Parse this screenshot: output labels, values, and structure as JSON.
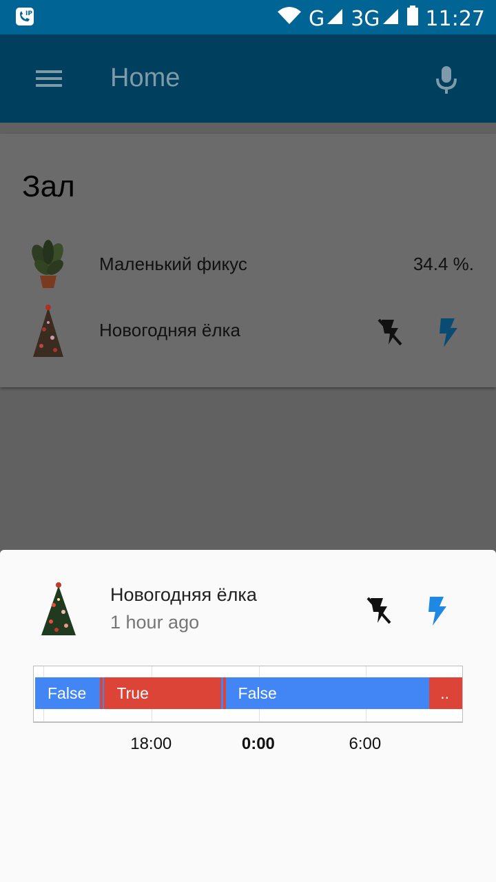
{
  "status_bar": {
    "time": "11:27",
    "network_1": "G",
    "network_2": "3G",
    "icons": [
      "sip-call-icon",
      "wifi-icon",
      "signal-icon",
      "battery-icon"
    ]
  },
  "app_bar": {
    "title": "Home",
    "menu_icon": "hamburger-menu-icon",
    "voice_icon": "microphone-icon"
  },
  "card": {
    "room": "Зал",
    "entities": [
      {
        "name": "Маленький фикус",
        "value": "34.4 %.",
        "icon": "ficus-plant-icon"
      },
      {
        "name": "Новогодняя ёлка",
        "icon": "christmas-tree-icon",
        "off_icon": "flash-off-icon",
        "on_icon": "flash-icon"
      }
    ]
  },
  "more_info": {
    "name": "Новогодняя ёлка",
    "last_changed": "1 hour ago",
    "icon": "christmas-tree-icon",
    "off_icon": "flash-off-icon",
    "on_icon": "flash-icon",
    "timeline": {
      "segments": [
        {
          "label": "False",
          "state": "false",
          "start": 0.0,
          "end": 0.152
        },
        {
          "label": "",
          "state": "true",
          "start": 0.152,
          "end": 0.158
        },
        {
          "label": "",
          "state": "false",
          "start": 0.158,
          "end": 0.162
        },
        {
          "label": "True",
          "state": "true",
          "start": 0.162,
          "end": 0.435
        },
        {
          "label": "",
          "state": "false",
          "start": 0.435,
          "end": 0.44
        },
        {
          "label": "",
          "state": "true",
          "start": 0.44,
          "end": 0.446
        },
        {
          "label": "False",
          "state": "false",
          "start": 0.446,
          "end": 0.923
        },
        {
          "label": "..",
          "state": "true",
          "start": 0.923,
          "end": 1.0
        }
      ],
      "ticks": [
        {
          "label": "18:00",
          "pos": 0.273,
          "bold": false
        },
        {
          "label": "0:00",
          "pos": 0.524,
          "bold": true
        },
        {
          "label": "6:00",
          "pos": 0.774,
          "bold": false
        }
      ],
      "colors": {
        "true": "#db4437",
        "false": "#4285f4"
      }
    }
  }
}
